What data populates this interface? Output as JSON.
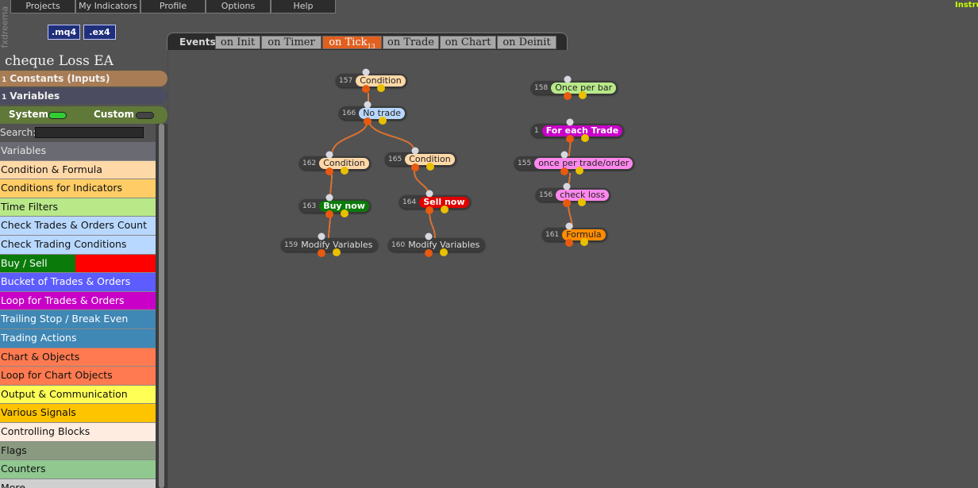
{
  "brand_vertical": "fxdreema",
  "menu": [
    "Projects",
    "My Indicators",
    "Profile",
    "Options",
    "Help"
  ],
  "top_right_link": "Instru",
  "ext_buttons": [
    ".mq4",
    ".ex4"
  ],
  "project_title": "cheque Loss EA",
  "sections": {
    "constants": {
      "num": "1",
      "label": "Constants (Inputs)",
      "color": "#a87c55"
    },
    "variables": {
      "num": "1",
      "label": "Variables",
      "color": "#4c4c60"
    }
  },
  "system_toggle": {
    "system_label": "System",
    "custom_label": "Custom",
    "system_on": true,
    "custom_on": false
  },
  "search": {
    "label": "Search:",
    "value": ""
  },
  "categories": [
    {
      "label": "Variables",
      "bg": "#6a6a72",
      "fg": "#e6e6e6"
    },
    {
      "label": "Condition & Formula",
      "bg": "#ffd8a8",
      "fg": "#111"
    },
    {
      "label": "Conditions for Indicators",
      "bg": "#ffcc66",
      "fg": "#111"
    },
    {
      "label": "Time Filters",
      "bg": "#b8e888",
      "fg": "#111"
    },
    {
      "label": "Check Trades & Orders Count",
      "bg": "#b8d8ff",
      "fg": "#111"
    },
    {
      "label": "Check Trading Conditions",
      "bg": "#b8d8ff",
      "fg": "#111"
    },
    {
      "label": "Buy / Sell",
      "bg": "#0a7a0a",
      "fg": "#ffffff"
    },
    {
      "label": "Bucket of Trades & Orders",
      "bg": "#5c5cff",
      "fg": "#ffffff"
    },
    {
      "label": "Loop for Trades & Orders",
      "bg": "#c800c8",
      "fg": "#ffffff"
    },
    {
      "label": "Trailing Stop / Break Even",
      "bg": "#3f87b5",
      "fg": "#ffffff"
    },
    {
      "label": "Trading Actions",
      "bg": "#3f87b5",
      "fg": "#ffffff"
    },
    {
      "label": "Chart & Objects",
      "bg": "#ff7a50",
      "fg": "#111"
    },
    {
      "label": "Loop for Chart Objects",
      "bg": "#ff7a50",
      "fg": "#111"
    },
    {
      "label": "Output & Communication",
      "bg": "#ffff55",
      "fg": "#111"
    },
    {
      "label": "Various Signals",
      "bg": "#ffc400",
      "fg": "#111"
    },
    {
      "label": "Controlling Blocks",
      "bg": "#ffece0",
      "fg": "#111"
    },
    {
      "label": "Flags",
      "bg": "#8a9a80",
      "fg": "#111"
    },
    {
      "label": "Counters",
      "bg": "#90c890",
      "fg": "#111"
    },
    {
      "label": "More",
      "bg": "#d0d0d0",
      "fg": "#111"
    }
  ],
  "events": {
    "label": "Events",
    "tabs": [
      "on Init",
      "on Timer",
      "on Tick",
      "on Trade",
      "on Chart",
      "on Deinit"
    ],
    "active": "on Tick",
    "active_badge": "13"
  },
  "blocks": [
    {
      "id": "157",
      "label": "Condition",
      "color": "#ffd8a8"
    },
    {
      "id": "166",
      "label": "No trade",
      "color": "#b8d8ff"
    },
    {
      "id": "162",
      "label": "Condition",
      "color": "#ffd8a8"
    },
    {
      "id": "165",
      "label": "Condition",
      "color": "#ffd8a8"
    },
    {
      "id": "163",
      "label": "Buy now",
      "color": "#0a7a0a"
    },
    {
      "id": "164",
      "label": "Sell now",
      "color": "#e00000"
    },
    {
      "id": "159",
      "label": "Modify Variables",
      "color": "#3c3c3c"
    },
    {
      "id": "160",
      "label": "Modify Variables",
      "color": "#3c3c3c"
    },
    {
      "id": "158",
      "label": "Once per bar",
      "color": "#b8e888"
    },
    {
      "id": "1",
      "label": "For each Trade",
      "color": "#c800c8"
    },
    {
      "id": "155",
      "label": "once per trade/order",
      "color": "#ff88ee"
    },
    {
      "id": "156",
      "label": "check loss",
      "color": "#ff88ee"
    },
    {
      "id": "161",
      "label": "Formula",
      "color": "#ff8c00"
    }
  ]
}
